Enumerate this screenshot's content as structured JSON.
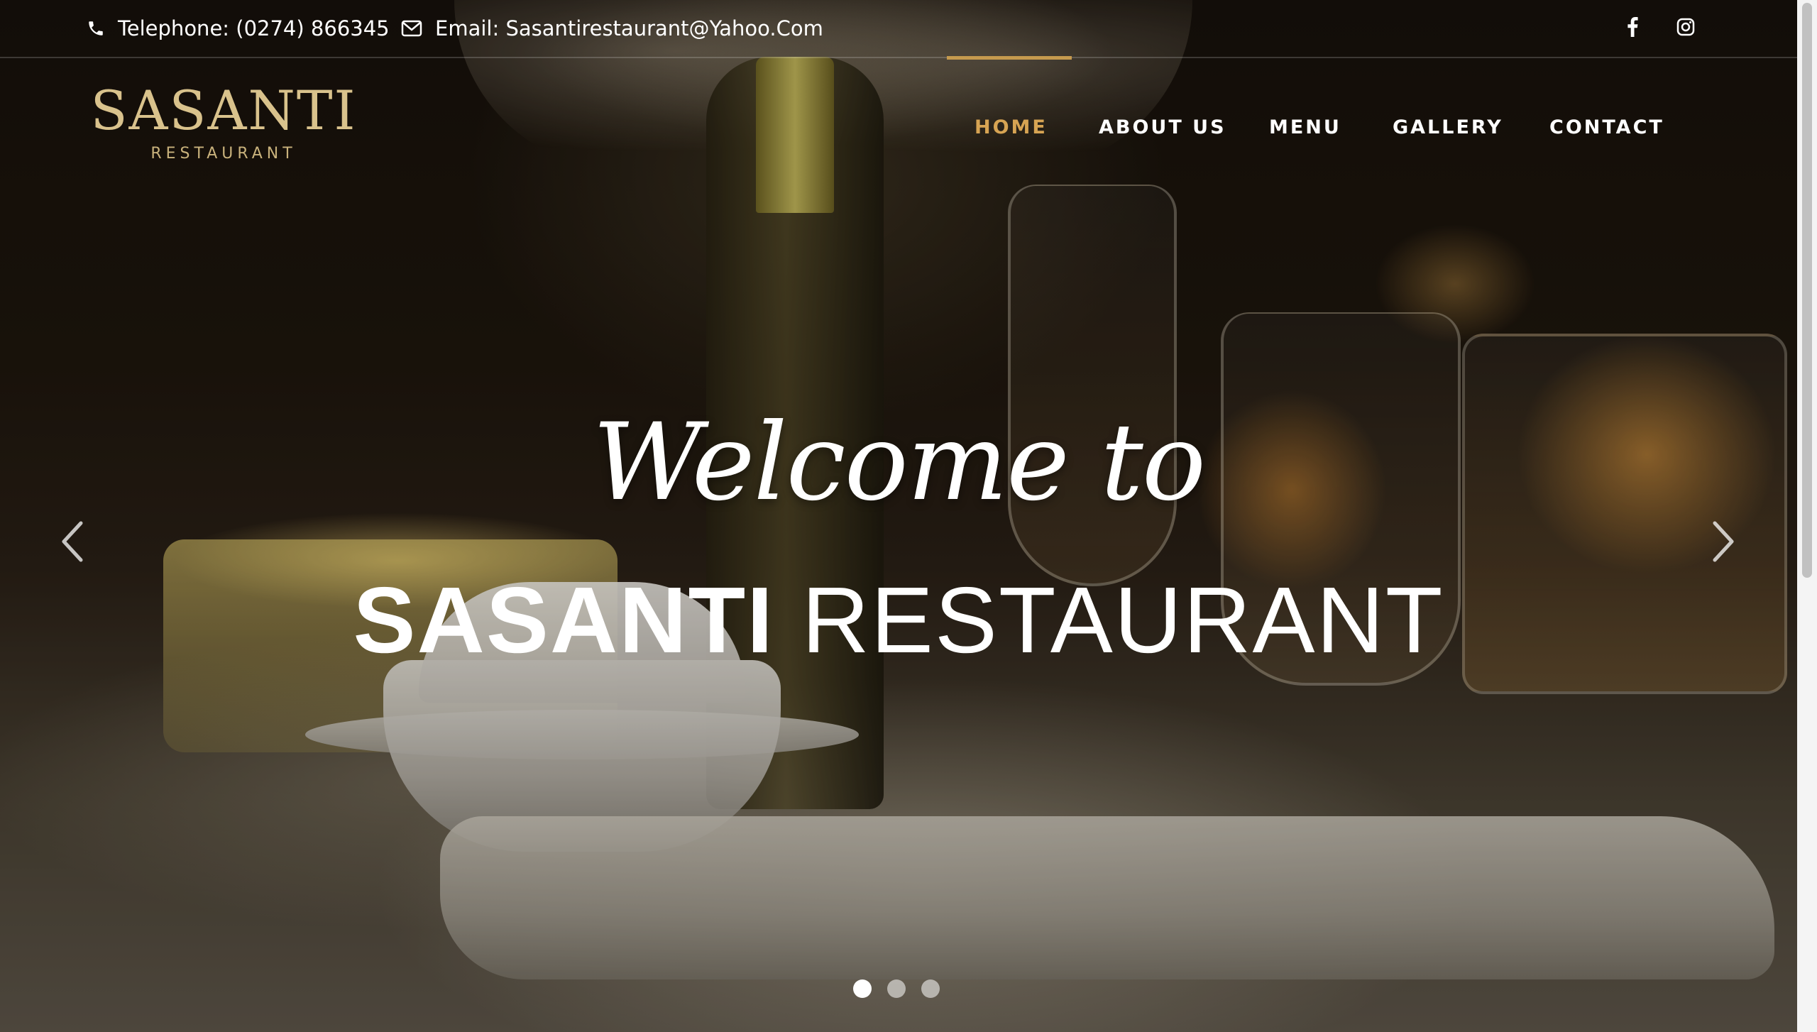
{
  "topbar": {
    "phone": "Telephone: (0274) 866345",
    "email": "Email: Sasantirestaurant@Yahoo.Com",
    "social_icons": [
      "facebook-icon",
      "instagram-icon"
    ]
  },
  "logo": {
    "main": "SASANTI",
    "sub": "RESTAURANT"
  },
  "nav": {
    "items": [
      {
        "label": "HOME",
        "active": true
      },
      {
        "label": "ABOUT US",
        "active": false
      },
      {
        "label": "MENU",
        "active": false
      },
      {
        "label": "GALLERY",
        "active": false
      },
      {
        "label": "CONTACT",
        "active": false
      }
    ]
  },
  "hero": {
    "welcome": "Welcome to",
    "title_bold": "SASANTI",
    "title_light": "RESTAURANT"
  },
  "slider": {
    "slide_count": 3,
    "active_index": 0
  },
  "colors": {
    "accent": "#d7a453",
    "indicator": "#c59a4e",
    "logo": "#d9c28c",
    "text": "#ffffff"
  }
}
